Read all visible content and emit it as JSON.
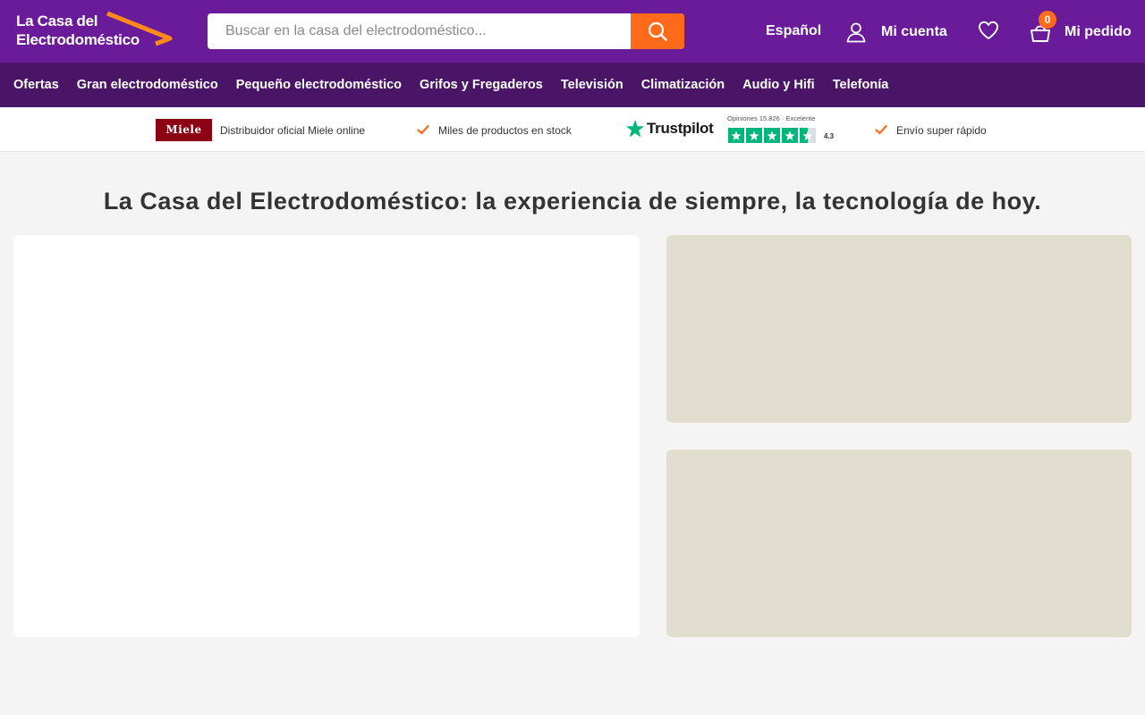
{
  "header": {
    "logo_line1": "La Casa del",
    "logo_line2": "Electrodoméstico",
    "search_placeholder": "Buscar en la casa del electrodoméstico...",
    "language": "Español",
    "account": "Mi cuenta",
    "cart_count": "0",
    "cart": "Mi pedido"
  },
  "nav": {
    "items": [
      "Ofertas",
      "Gran electrodoméstico",
      "Pequeño electrodoméstico",
      "Grifos y Fregaderos",
      "Televisión",
      "Climatización",
      "Audio y Hifi",
      "Telefonía"
    ]
  },
  "trust": {
    "miele_logo": "Miele",
    "miele_text": "Distribuidor oficial Miele online",
    "stock_text": "Miles de productos en stock",
    "trustpilot_name": "Trustpilot",
    "reviews_text": "Opiniones 15.826 · Excelente",
    "score": "4.3",
    "shipping_text": "Envío super rápido"
  },
  "main": {
    "headline": "La Casa del Electrodoméstico: la experiencia de siempre, la tecnología de hoy."
  },
  "colors": {
    "header_bg": "#6a1b9a",
    "nav_bg": "#4a1567",
    "accent": "#ff6b1a",
    "trustpilot_green": "#00b67a",
    "banner_placeholder": "#e1ddcf"
  }
}
